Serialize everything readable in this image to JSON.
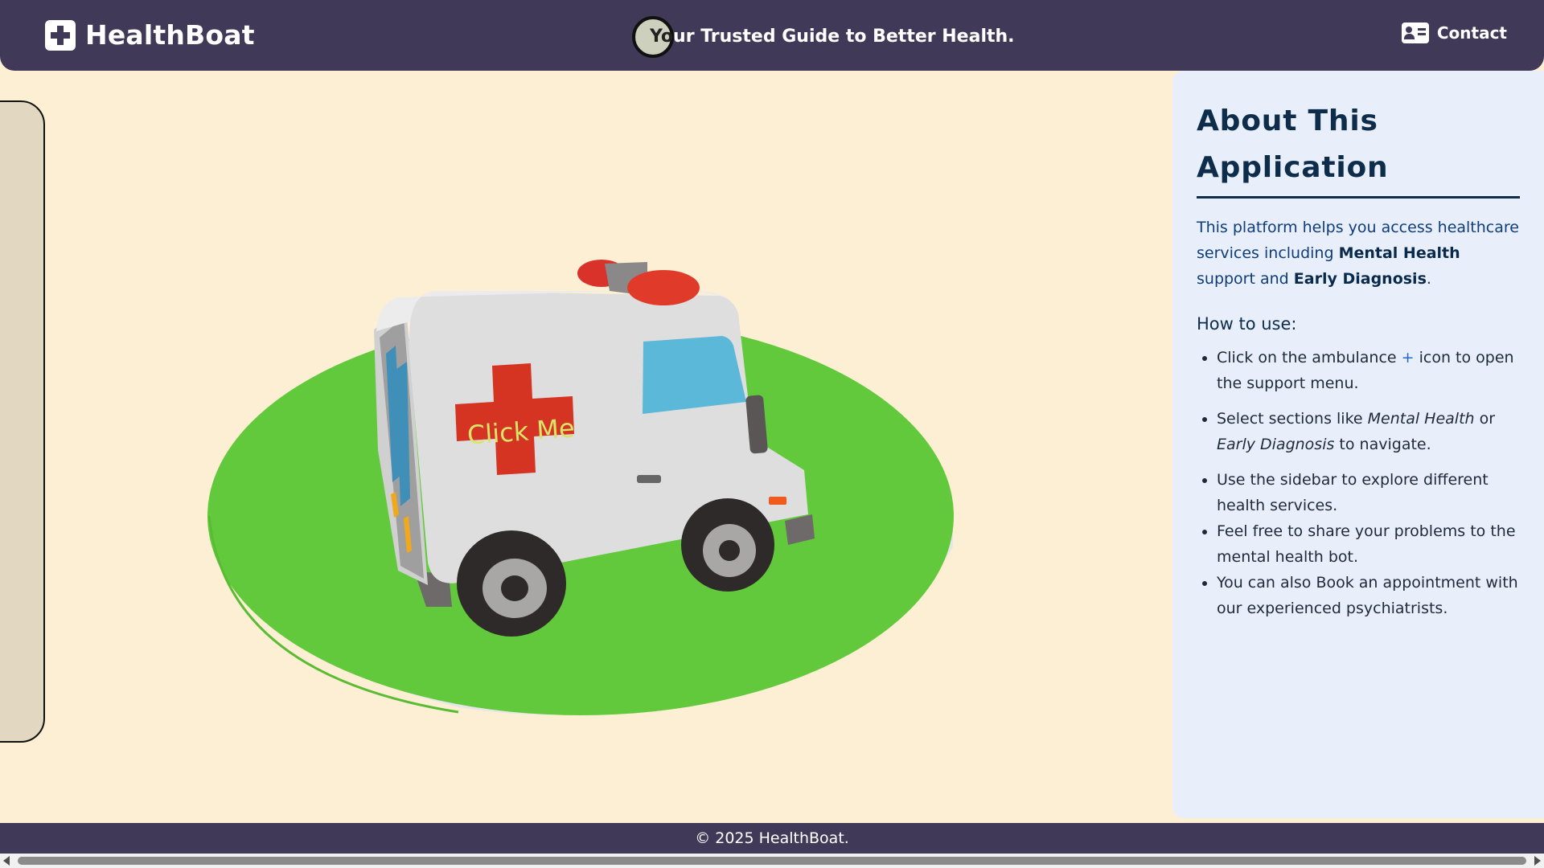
{
  "header": {
    "brand": "HealthBoat",
    "tagline_part1": "Yo",
    "tagline_part2": "ur Trusted Guide to Better Health.",
    "contact_label": "Contact"
  },
  "scene": {
    "button_label": "Click Me"
  },
  "about": {
    "title": "About This Application",
    "intro_prefix": "This platform helps you access healthcare services including ",
    "intro_bold1": "Mental Health",
    "intro_mid": " support and ",
    "intro_bold2": "Early Diagnosis",
    "intro_suffix": ".",
    "howto_heading": "How to use:",
    "items": [
      {
        "a": "Click on the ambulance ",
        "plus": "+",
        "b": " icon to open the support menu."
      },
      {
        "a": "Select sections like ",
        "em1": "Mental Health",
        "b": " or ",
        "em2": "Early Diagnosis",
        "c": " to navigate."
      },
      {
        "text": "Use the sidebar to explore different health services."
      },
      {
        "text": "Feel free to share your problems to the mental health bot."
      },
      {
        "text": "You can also Book an appointment with our experienced psychiatrists."
      }
    ]
  },
  "footer": {
    "copyright": "© 2025 HealthBoat."
  },
  "colors": {
    "header_bg": "#403a58",
    "page_bg": "#fdefd3",
    "panel_bg": "#e8effb",
    "grass": "#62c93c",
    "ambulance_cross": "#d63422",
    "click_text": "#d9e46a"
  }
}
